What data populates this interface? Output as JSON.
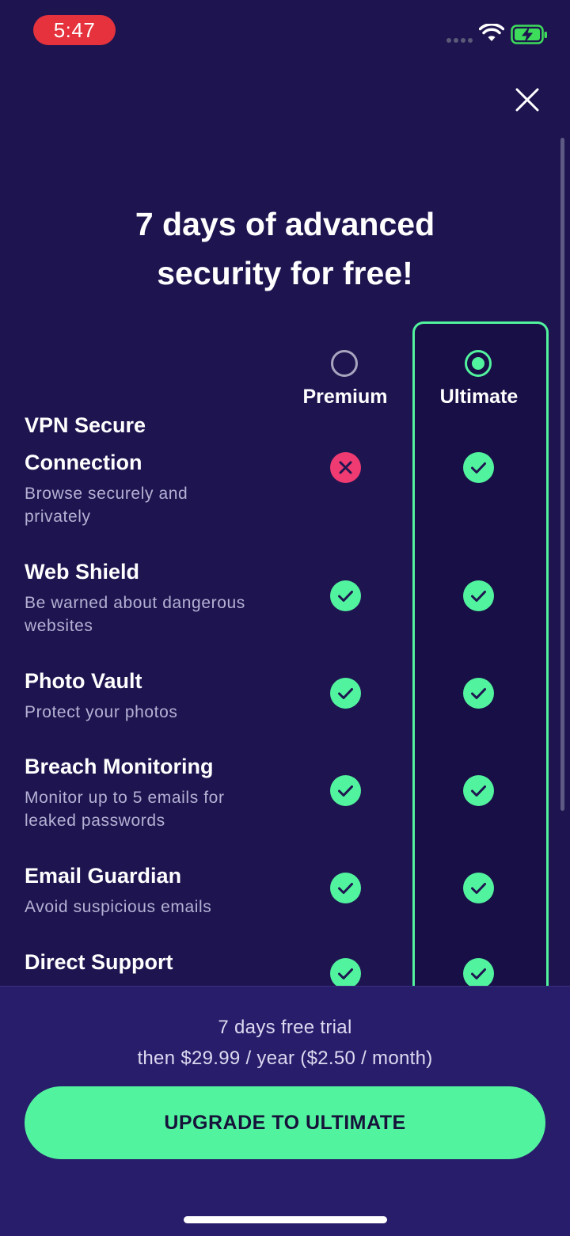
{
  "status_bar": {
    "time": "5:47",
    "wifi_icon": "wifi-icon",
    "battery_icon": "battery-charging-icon",
    "battery_color": "#3ddc5a"
  },
  "close_icon": "close-icon",
  "headline": {
    "line1": "7 days of advanced",
    "line2": "security for free!"
  },
  "plans": {
    "premium": {
      "label": "Premium",
      "selected": false
    },
    "ultimate": {
      "label": "Ultimate",
      "selected": true
    }
  },
  "features": [
    {
      "title_line1": "VPN Secure",
      "title_line2": "Connection",
      "desc_line1": "Browse securely and",
      "desc_line2": "privately",
      "premium": false,
      "ultimate": true
    },
    {
      "title": "Web Shield",
      "desc_line1": "Be warned about dangerous",
      "desc_line2": "websites",
      "premium": true,
      "ultimate": true
    },
    {
      "title": "Photo Vault",
      "desc": "Protect your photos",
      "premium": true,
      "ultimate": true
    },
    {
      "title": "Breach Monitoring",
      "desc_line1": "Monitor up to 5 emails for",
      "desc_line2": "leaked passwords",
      "premium": true,
      "ultimate": true
    },
    {
      "title": "Email Guardian",
      "desc": "Avoid suspicious emails",
      "premium": true,
      "ultimate": true
    },
    {
      "title": "Direct Support",
      "premium": true,
      "ultimate": true
    }
  ],
  "footer": {
    "trial_line1": "7 days free trial",
    "trial_line2": "then $29.99 / year ($2.50 / month)",
    "cta_label": "UPGRADE TO ULTIMATE"
  },
  "colors": {
    "background": "#1e1550",
    "accent": "#52f39e",
    "negative": "#ef3a72",
    "footer_bg": "#281d6b"
  }
}
